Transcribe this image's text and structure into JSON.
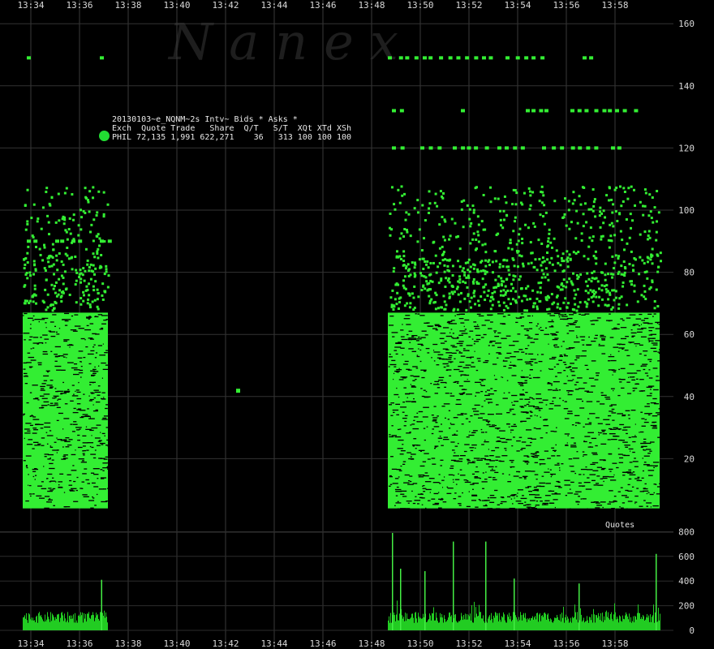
{
  "watermark": "Nanex",
  "legend": {
    "title": "20130103~e_NQNM~2s Intv~ Bids * Asks *",
    "header": "Exch  Quote Trade   Share  Q/T   S/T  XQt XTd XSh",
    "row": "PHIL 72,135 1,991 622,271    36   313 100 100 100",
    "marker_color": "#22dd33"
  },
  "quotes_label": "Quotes",
  "chart_data": [
    {
      "type": "scatter",
      "title": "",
      "x_ticks": [
        "13:34",
        "13:36",
        "13:38",
        "13:40",
        "13:42",
        "13:44",
        "13:46",
        "13:48",
        "13:50",
        "13:52",
        "13:54",
        "13:56",
        "13:58"
      ],
      "y_ticks": [
        20,
        40,
        60,
        80,
        100,
        120,
        140,
        160
      ],
      "xlim_minutes": [
        "13:33",
        "14:00"
      ],
      "ylim": [
        0,
        165
      ],
      "grid": true,
      "series_color": "#33ee33",
      "dense_bands": [
        {
          "x_start": "13:33:40",
          "x_end": "13:37:10",
          "y_low": 4,
          "y_high": 67
        },
        {
          "x_start": "13:48:40",
          "x_end": "13:59:50",
          "y_low": 4,
          "y_high": 67
        }
      ],
      "scattered_levels": [
        {
          "y": 149,
          "x_ranges": [
            [
              "13:33:50",
              "13:34:00"
            ],
            [
              "13:36:50",
              "13:37:00"
            ],
            [
              "13:48:40",
              "13:53:00"
            ],
            [
              "13:53:30",
              "13:55:00"
            ],
            [
              "13:56:40",
              "13:57:20"
            ]
          ]
        },
        {
          "y": 132,
          "x_ranges": [
            [
              "13:48:50",
              "13:49:10"
            ],
            [
              "13:51:40",
              "13:51:50"
            ],
            [
              "13:54:20",
              "13:55:10"
            ],
            [
              "13:56:10",
              "13:58:50"
            ]
          ]
        },
        {
          "y": 120,
          "x_ranges": [
            [
              "13:48:50",
              "13:49:20"
            ],
            [
              "13:50:00",
              "13:51:00"
            ],
            [
              "13:51:20",
              "13:52:50"
            ],
            [
              "13:53:10",
              "13:54:10"
            ],
            [
              "13:55:00",
              "13:57:10"
            ],
            [
              "13:57:50",
              "13:58:20"
            ]
          ]
        },
        {
          "y": 90,
          "x_ranges": [
            [
              "13:33:50",
              "13:34:20"
            ],
            [
              "13:35:00",
              "13:35:20"
            ],
            [
              "13:35:40",
              "13:36:00"
            ],
            [
              "13:36:50",
              "13:37:10"
            ]
          ]
        }
      ],
      "isolated_points": [
        {
          "x": "13:42:30",
          "y": 42
        }
      ]
    },
    {
      "type": "bar",
      "title": "",
      "y_ticks": [
        0,
        200,
        400,
        600,
        800
      ],
      "ylim": [
        0,
        800
      ],
      "series_color": "#22cc22",
      "baseline_level": 60,
      "spikes": [
        {
          "x": "13:36:53",
          "y": 410
        },
        {
          "x": "13:48:50",
          "y": 790
        },
        {
          "x": "13:49:10",
          "y": 500
        },
        {
          "x": "13:50:10",
          "y": 480
        },
        {
          "x": "13:51:20",
          "y": 720
        },
        {
          "x": "13:52:40",
          "y": 720
        },
        {
          "x": "13:53:50",
          "y": 420
        },
        {
          "x": "13:56:30",
          "y": 380
        },
        {
          "x": "13:59:40",
          "y": 620
        }
      ]
    }
  ]
}
